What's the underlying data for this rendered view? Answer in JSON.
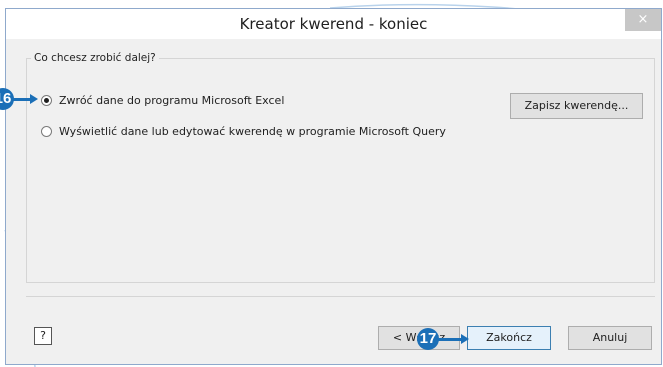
{
  "window": {
    "title": "Kreator kwerend - koniec",
    "close_icon": "close-icon",
    "close_glyph": "×"
  },
  "group": {
    "legend": "Co chcesz zrobić dalej?"
  },
  "options": [
    {
      "label": "Zwróć dane do programu Microsoft Excel",
      "checked": true
    },
    {
      "label": "Wyświetlić dane lub edytować kwerendę w programie Microsoft Query",
      "checked": false
    }
  ],
  "buttons": {
    "save_query": "Zapisz kwerendę...",
    "back": "< Wstecz",
    "finish": "Zakończ",
    "cancel": "Anuluj",
    "help_glyph": "?"
  },
  "callouts": {
    "step_16": "16",
    "step_17": "17",
    "color": "#1b6fb7"
  }
}
